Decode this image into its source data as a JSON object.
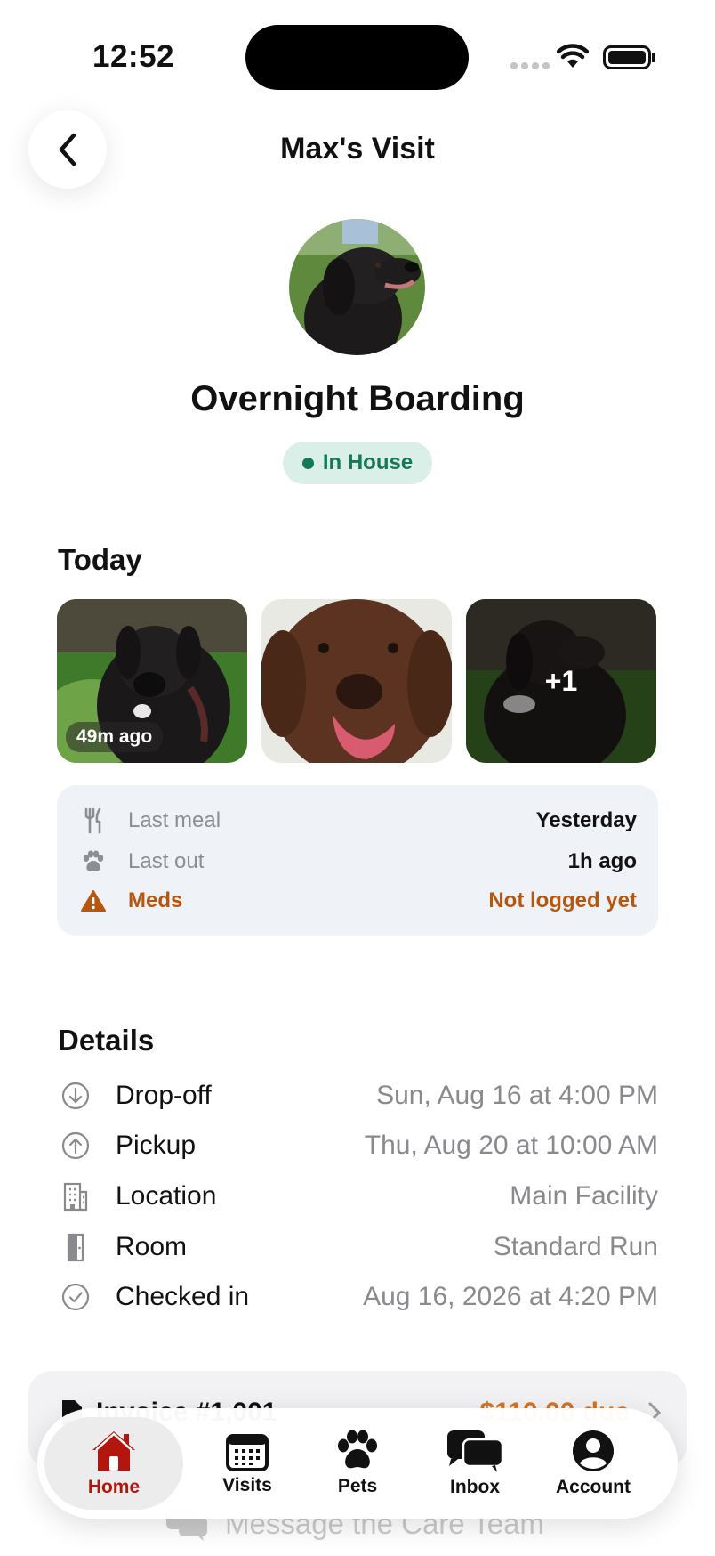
{
  "status_bar": {
    "time": "12:52"
  },
  "nav": {
    "title": "Max's Visit"
  },
  "visit": {
    "service": "Overnight Boarding",
    "status": "In House",
    "status_color": "#137a55"
  },
  "today": {
    "title": "Today",
    "photos": [
      {
        "caption": "49m ago"
      },
      {
        "caption": ""
      },
      {
        "overlay": "+1"
      }
    ],
    "care": [
      {
        "icon": "utensils-icon",
        "label": "Last meal",
        "value": "Yesterday"
      },
      {
        "icon": "paw-icon",
        "label": "Last out",
        "value": "1h ago"
      },
      {
        "icon": "warning-icon",
        "label": "Meds",
        "value": "Not logged yet",
        "color": "#b9560d"
      }
    ]
  },
  "details": {
    "title": "Details",
    "rows": [
      {
        "icon": "arrow-down-circle-icon",
        "label": "Drop-off",
        "value": "Sun, Aug 16 at 4:00 PM"
      },
      {
        "icon": "arrow-up-circle-icon",
        "label": "Pickup",
        "value": "Thu, Aug 20 at 10:00 AM"
      },
      {
        "icon": "building-icon",
        "label": "Location",
        "value": "Main Facility"
      },
      {
        "icon": "door-icon",
        "label": "Room",
        "value": "Standard Run"
      },
      {
        "icon": "check-circle-icon",
        "label": "Checked in",
        "value": "Aug 16, 2026 at 4:20 PM"
      }
    ]
  },
  "invoice": {
    "label": "Invoice #1,001",
    "amount": "$110.00 due"
  },
  "message": {
    "label": "Message the Care Team"
  },
  "tabs": [
    {
      "label": "Home",
      "icon": "home-icon",
      "active": true
    },
    {
      "label": "Visits",
      "icon": "calendar-icon"
    },
    {
      "label": "Pets",
      "icon": "paw-icon"
    },
    {
      "label": "Inbox",
      "icon": "chat-icon"
    },
    {
      "label": "Account",
      "icon": "account-icon"
    }
  ],
  "colors": {
    "accent": "#b3160f",
    "warning": "#b9560d",
    "success": "#137a55",
    "invoice_due": "#d9731a"
  }
}
